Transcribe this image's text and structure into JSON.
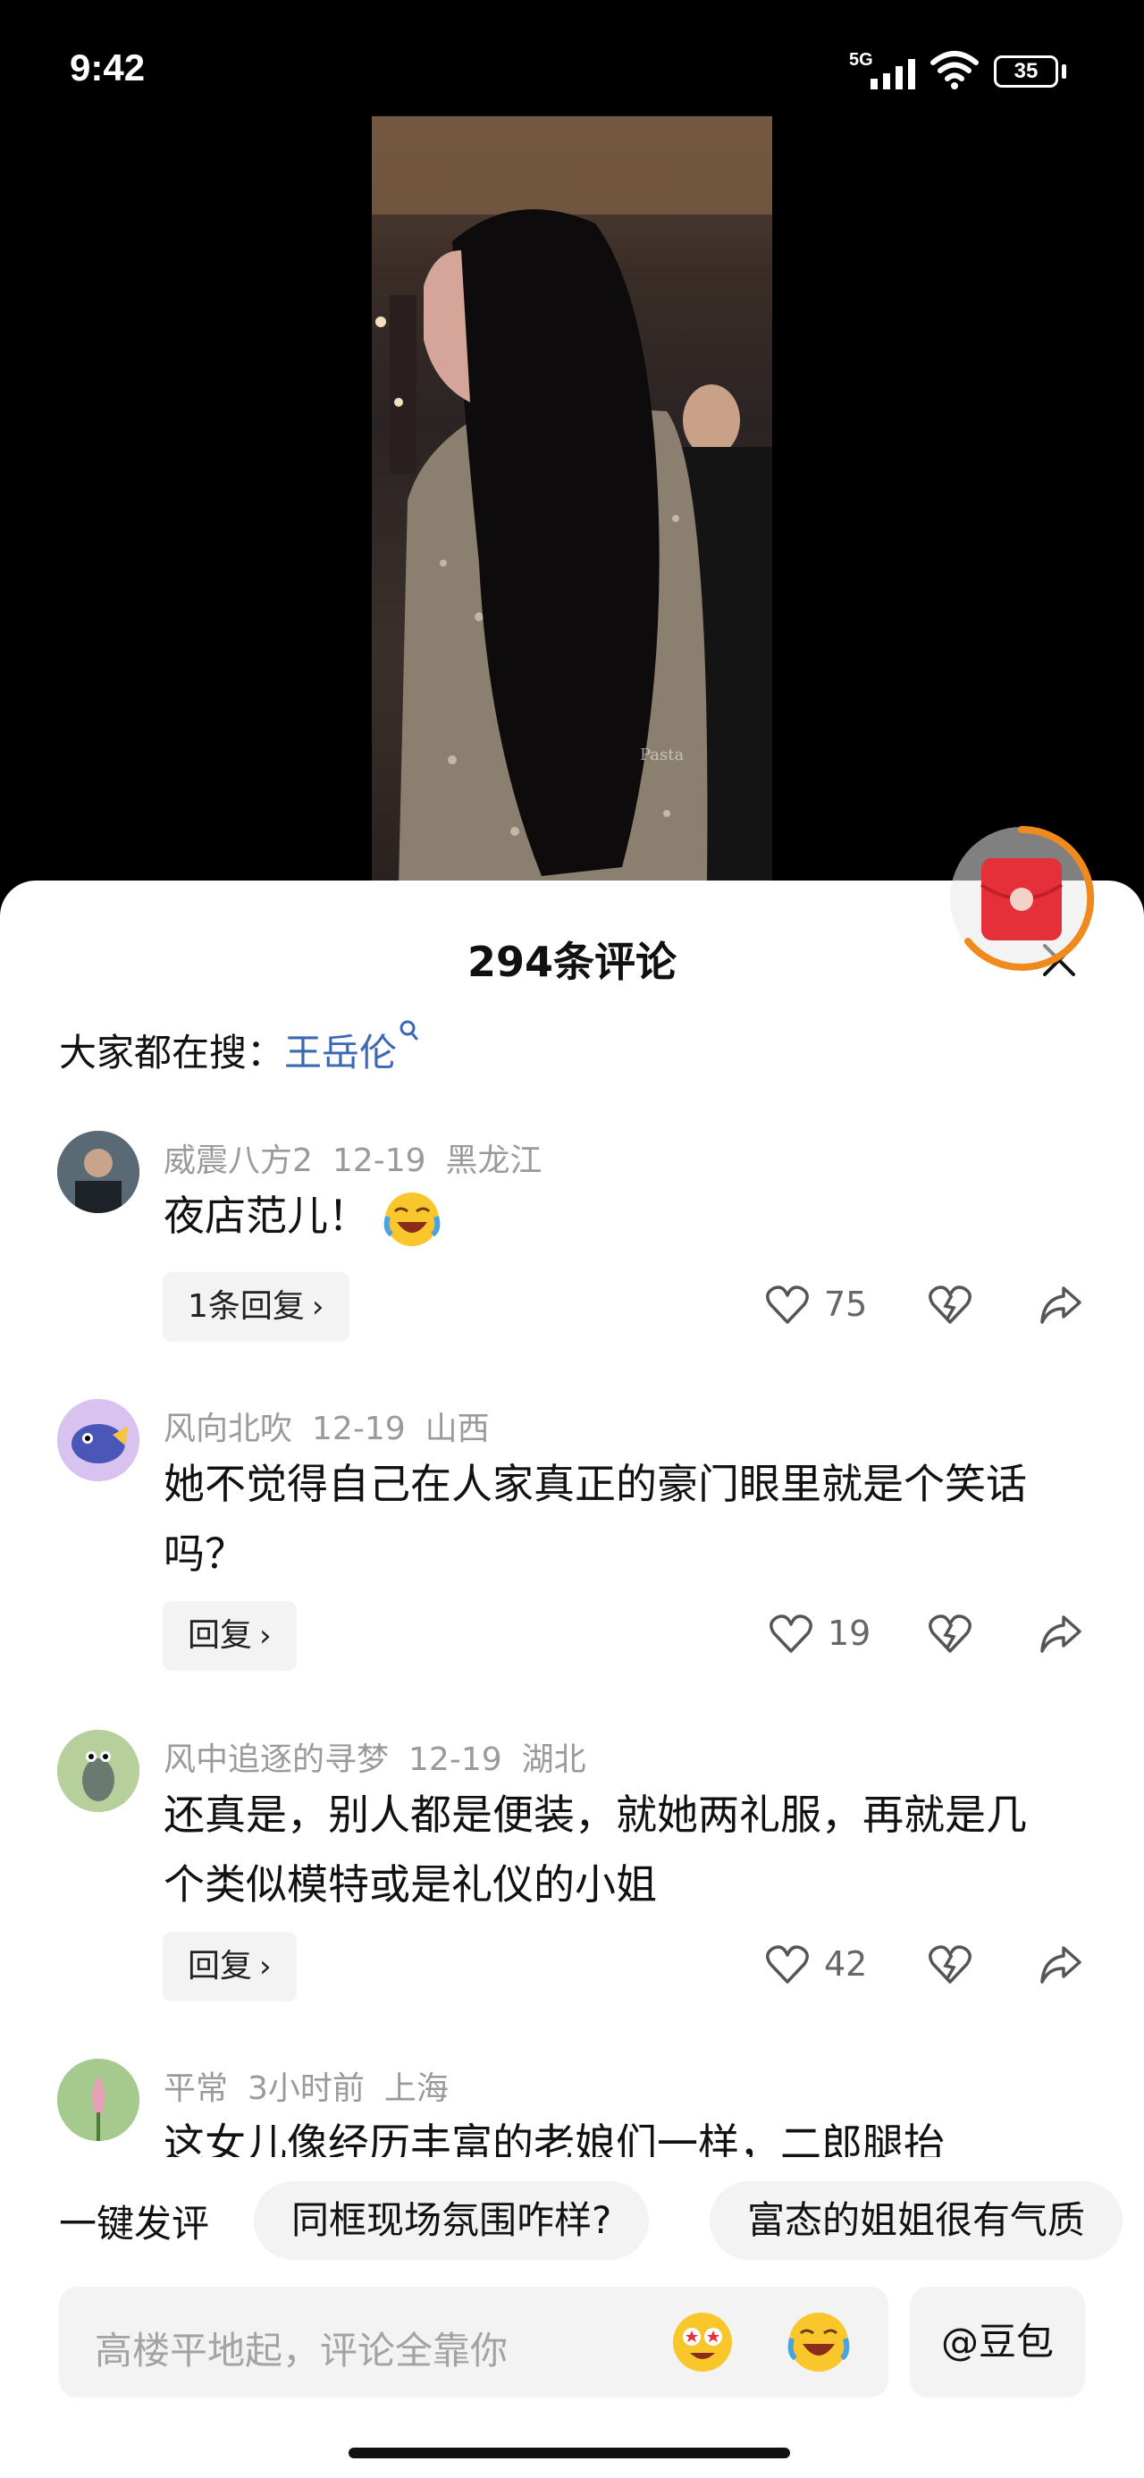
{
  "status_bar": {
    "time": "9:42",
    "network": "5G",
    "battery": "35"
  },
  "panel": {
    "title": "294条评论"
  },
  "search": {
    "prefix": "大家都在搜：",
    "keyword": "王岳伦"
  },
  "comments": [
    {
      "user": "威震八方2",
      "date": "12-19",
      "location": "黑龙江",
      "text": "夜店范儿！",
      "reply_label": "1条回复",
      "likes": "75"
    },
    {
      "user": "风向北吹",
      "date": "12-19",
      "location": "山西",
      "text": "她不觉得自己在人家真正的豪门眼里就是个笑话吗？",
      "reply_label": "回复",
      "likes": "19"
    },
    {
      "user": "风中追逐的寻梦",
      "date": "12-19",
      "location": "湖北",
      "text": "还真是，别人都是便装，就她两礼服，再就是几个类似模特或是礼仪的小姐",
      "reply_label": "回复",
      "likes": "42"
    },
    {
      "user": "平常",
      "date": "3小时前",
      "location": "上海",
      "text": "这女儿像经历丰富的老娘们一样，二郎腿抬"
    }
  ],
  "quick_comment": {
    "label": "一键发评",
    "chips": [
      "同框现场氛围咋样?",
      "富态的姐姐很有气质"
    ]
  },
  "input": {
    "placeholder": "高楼平地起，评论全靠你",
    "at_button": "@豆包"
  },
  "colors": {
    "link": "#3a68b6",
    "accent_orange": "#f08a1c",
    "red_packet": "#e5303a"
  },
  "icons": [
    "signal-icon",
    "wifi-icon",
    "battery-icon",
    "close-icon",
    "red-packet-icon",
    "search-icon",
    "heart-icon",
    "dislike-icon",
    "share-icon",
    "emoji-icon"
  ]
}
